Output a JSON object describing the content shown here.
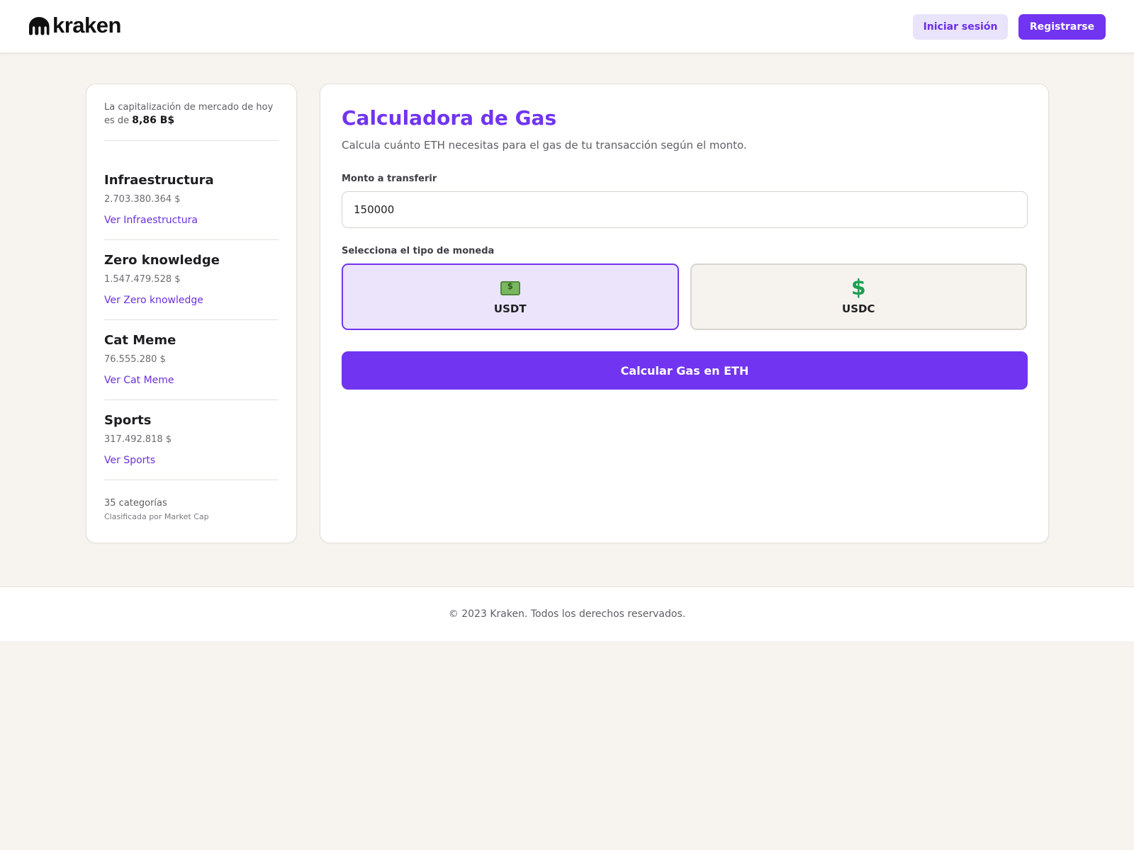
{
  "brand": {
    "name": "kraken",
    "logo_icon": "kraken-icon"
  },
  "header": {
    "login_label": "Iniciar sesión",
    "register_label": "Registrarse"
  },
  "sidebar": {
    "market_cap_prefix": "La capitalización de mercado de hoy es de",
    "market_cap_value": "8,86 B$",
    "categories": [
      {
        "name": "Infraestructura",
        "value": "2.703.380.364 $",
        "link": "Ver Infraestructura"
      },
      {
        "name": "Zero knowledge",
        "value": "1.547.479.528 $",
        "link": "Ver Zero knowledge"
      },
      {
        "name": "Cat Meme",
        "value": "76.555.280 $",
        "link": "Ver Cat Meme"
      },
      {
        "name": "Sports",
        "value": "317.492.818 $",
        "link": "Ver Sports"
      }
    ],
    "count_label": "35 categorías",
    "sorted_label": "Clasificada por Market Cap"
  },
  "calculator": {
    "title": "Calculadora de Gas",
    "subtitle": "Calcula cuánto ETH necesitas para el gas de tu transacción según el monto.",
    "amount_label": "Monto a transferir",
    "amount_value": "150000",
    "currency_label": "Selecciona el tipo de moneda",
    "currencies": [
      {
        "label": "USDT",
        "icon": "money-bill-icon",
        "selected": true
      },
      {
        "label": "USDC",
        "icon": "dollar-sign-icon",
        "selected": false
      }
    ],
    "submit_label": "Calcular Gas en ETH"
  },
  "footer": {
    "text": "© 2023 Kraken. Todos los derechos reservados."
  },
  "colors": {
    "accent": "#7134f0",
    "accent_light": "#ebe4fb",
    "page_bg": "#f7f4ef",
    "dollar_green": "#1f9e52"
  }
}
